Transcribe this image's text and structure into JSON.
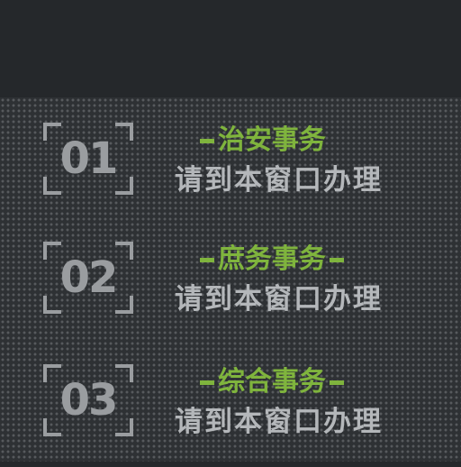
{
  "rows": [
    {
      "number": "01",
      "title": "治安事务",
      "has_left_dash": true,
      "has_right_dash": false,
      "subtitle": "请到本窗口办理"
    },
    {
      "number": "02",
      "title": "庶务事务",
      "has_left_dash": true,
      "has_right_dash": true,
      "subtitle": "请到本窗口办理"
    },
    {
      "number": "03",
      "title": "综合事务",
      "has_left_dash": true,
      "has_right_dash": true,
      "subtitle": "请到本窗口办理"
    }
  ],
  "colors": {
    "background": "#25282b",
    "accent_green": "#7fb43d",
    "text_gray": "#b4b7ba",
    "badge_gray": "#9a9da0"
  }
}
